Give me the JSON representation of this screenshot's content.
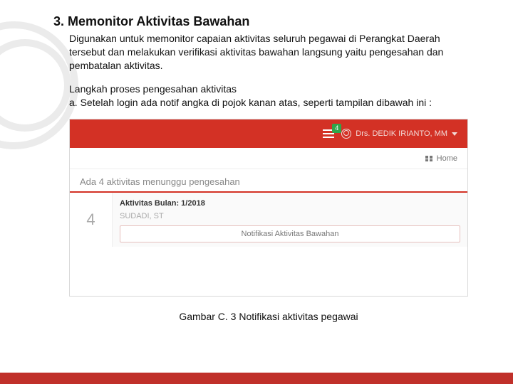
{
  "section": {
    "title": "3. Memonitor Aktivitas Bawahan",
    "para1": "Digunakan untuk memonitor capaian aktivitas seluruh pegawai di Perangkat Daerah tersebut dan melakukan verifikasi aktivitas bawahan langsung yaitu pengesahan dan pembatalan aktivitas.",
    "para2": "Langkah proses pengesahan aktivitas",
    "para3": "a. Setelah login ada notif angka di pojok kanan atas, seperti tampilan dibawah ini :"
  },
  "app": {
    "notif_count": "4",
    "user_name": "Drs. DEDIK IRIANTO, MM",
    "home_label": "Home",
    "waiting_text": "Ada 4 aktivitas menunggu pengesahan",
    "notif": {
      "badge": "4",
      "month_line": "Aktivitas Bulan: 1/2018",
      "person": "SUDADI, ST",
      "box": "Notifikasi Aktivitas Bawahan"
    }
  },
  "caption": "Gambar C. 3 Notifikasi aktivitas pegawai"
}
